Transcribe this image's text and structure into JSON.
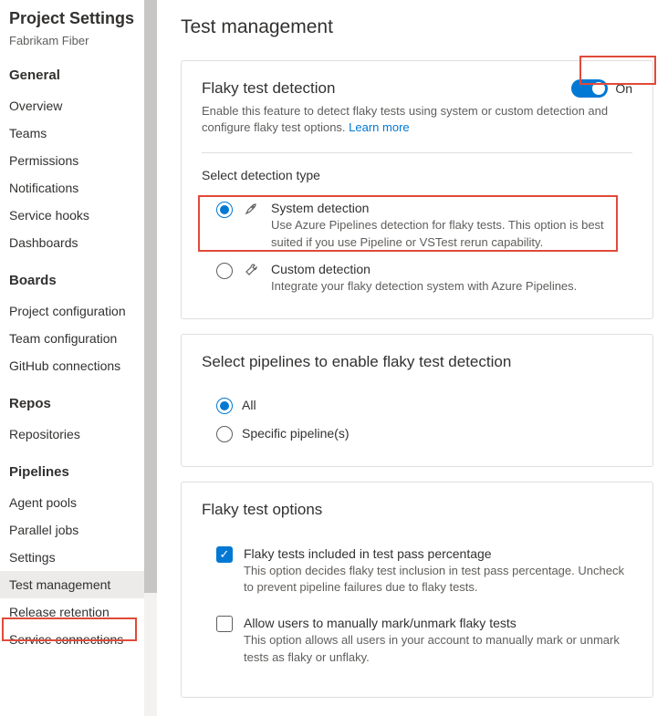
{
  "sidebar": {
    "title": "Project Settings",
    "project": "Fabrikam Fiber",
    "sections": [
      {
        "heading": "General",
        "items": [
          "Overview",
          "Teams",
          "Permissions",
          "Notifications",
          "Service hooks",
          "Dashboards"
        ]
      },
      {
        "heading": "Boards",
        "items": [
          "Project configuration",
          "Team configuration",
          "GitHub connections"
        ]
      },
      {
        "heading": "Repos",
        "items": [
          "Repositories"
        ]
      },
      {
        "heading": "Pipelines",
        "items": [
          "Agent pools",
          "Parallel jobs",
          "Settings",
          "Test management",
          "Release retention",
          "Service connections"
        ]
      }
    ]
  },
  "page": {
    "title": "Test management"
  },
  "flaky": {
    "title": "Flaky test detection",
    "desc": "Enable this feature to detect flaky tests using system or custom detection and configure flaky test options. ",
    "learn_more": "Learn more",
    "toggle_label": "On",
    "select_heading": "Select detection type",
    "system": {
      "title": "System detection",
      "desc": "Use Azure Pipelines detection for flaky tests. This option is best suited if you use Pipeline or VSTest rerun capability."
    },
    "custom": {
      "title": "Custom detection",
      "desc": "Integrate your flaky detection system with Azure Pipelines."
    }
  },
  "pipelines": {
    "title": "Select pipelines to enable flaky test detection",
    "all": "All",
    "specific": "Specific pipeline(s)"
  },
  "options": {
    "title": "Flaky test options",
    "opt1": {
      "title": "Flaky tests included in test pass percentage",
      "desc": "This option decides flaky test inclusion in test pass percentage. Uncheck to prevent pipeline failures due to flaky tests."
    },
    "opt2": {
      "title": "Allow users to manually mark/unmark flaky tests",
      "desc": "This option allows all users in your account to manually mark or unmark tests as flaky or unflaky."
    }
  }
}
